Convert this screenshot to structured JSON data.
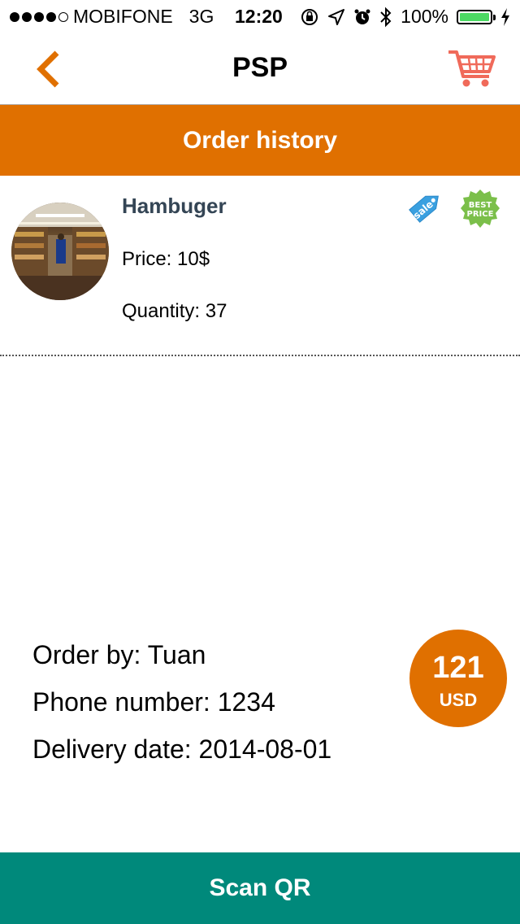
{
  "status_bar": {
    "carrier": "MOBIFONE",
    "network": "3G",
    "time": "12:20",
    "battery_text": "100%",
    "battery_level": 1.0,
    "signal_bars": 4,
    "signal_total": 5
  },
  "nav": {
    "title": "PSP",
    "back_icon": "chevron-left-icon",
    "cart_icon": "shopping-cart-icon"
  },
  "section": {
    "title": "Order history"
  },
  "order_item": {
    "name": "Hambuger",
    "price": "Price: 10$",
    "quantity": "Quantity: 37",
    "badges": {
      "sale": "sale",
      "best_line1": "BEST",
      "best_line2": "PRICE"
    }
  },
  "order_info": {
    "order_by": "Order by: Tuan",
    "phone": "Phone number: 1234",
    "delivery": "Delivery date: 2014-08-01",
    "total_amount": "121",
    "total_unit": "USD"
  },
  "actions": {
    "scan_label": "Scan QR"
  },
  "colors": {
    "accent": "#e07000",
    "primary_button": "#00897b",
    "cart": "#f06a5a",
    "sale_tag": "#3aa0e0",
    "best_badge": "#7bbf4a"
  }
}
